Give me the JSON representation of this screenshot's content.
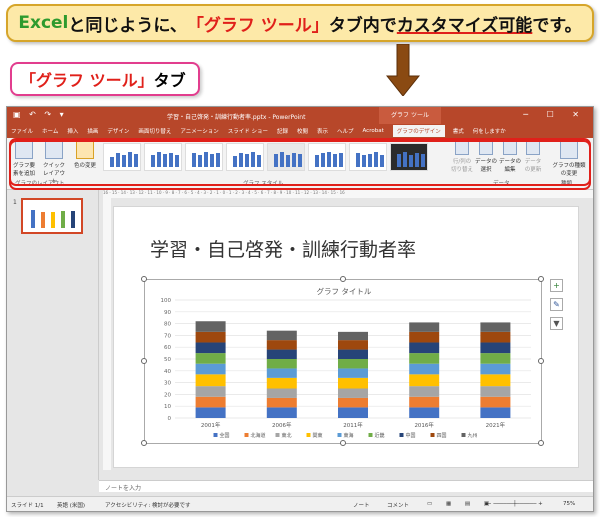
{
  "banner": {
    "part1": "Excel",
    "part2": "と同じように、",
    "part3": "「グラフ ツール」",
    "part4": "タブ内で",
    "part5": "カスタマイズ可能",
    "part6": "です。"
  },
  "tag": {
    "part1": "「グラフ ツール」",
    "part2": "タブ"
  },
  "window": {
    "title": "学習・自己啓発・訓練行動者率.pptx - PowerPoint",
    "context_tab": "グラフ ツール",
    "tabs": [
      "ファイル",
      "ホーム",
      "挿入",
      "描画",
      "デザイン",
      "画面切り替え",
      "アニメーション",
      "スライド ショー",
      "記録",
      "校閲",
      "表示",
      "ヘルプ",
      "Acrobat",
      "グラフのデザイン",
      "書式"
    ],
    "active_tab": "グラフのデザイン",
    "tell_me": "何をしますか"
  },
  "ribbon": {
    "add_element": "グラフ要素を追加",
    "quick_layout": "クイックレイアウト",
    "change_colors": "色の変更",
    "layout_group": "グラフのレイアウト",
    "styles_group": "グラフ スタイル",
    "switch_rowcol": "行/列の切り替え",
    "select_data": "データの選択",
    "edit_data": "データの編集",
    "refresh_data": "データの更新",
    "data_group": "データ",
    "change_type": "グラフの種類の変更",
    "type_group": "種類"
  },
  "ruler_text": "16 · 15 · 14 · 13 · 12 · 11 · 10 · 9 · 8 · 7 · 6 · 5 · 4 · 3 · 2 · 1 · 0 · 1 · 2 · 3 · 4 · 5 · 6 · 7 · 8 · 9 · 10 · 11 · 12 · 13 · 14 · 15 · 16",
  "slide_number": "1",
  "slide_title": "学習・自己啓発・訓練行動者率",
  "notes_placeholder": "ノートを入力",
  "status": {
    "slide": "スライド 1/1",
    "language": "英語 (米国)",
    "accessibility": "アクセシビリティ: 検討が必要です",
    "notes": "ノート",
    "comments": "コメント",
    "zoom": "75%"
  },
  "colors": {
    "powerpoint": "#b7472a",
    "highlight": "#e0201a"
  },
  "chart_data": {
    "type": "bar",
    "title": "グラフ タイトル",
    "categories": [
      "2001年",
      "2006年",
      "2011年",
      "2016年",
      "2021年"
    ],
    "ylim": [
      0,
      100
    ],
    "yticks": [
      0,
      10,
      20,
      30,
      40,
      50,
      60,
      70,
      80,
      90,
      100
    ],
    "series": [
      {
        "name": "全国",
        "color": "#4472c4",
        "values": [
          9,
          9,
          9,
          9,
          9
        ]
      },
      {
        "name": "北海道",
        "color": "#ed7d31",
        "values": [
          9,
          8,
          8,
          9,
          9
        ]
      },
      {
        "name": "東北",
        "color": "#a5a5a5",
        "values": [
          9,
          8,
          8,
          9,
          9
        ]
      },
      {
        "name": "関東",
        "color": "#ffc000",
        "values": [
          10,
          9,
          9,
          10,
          10
        ]
      },
      {
        "name": "東海",
        "color": "#5b9bd5",
        "values": [
          9,
          8,
          8,
          9,
          9
        ]
      },
      {
        "name": "近畿",
        "color": "#70ad47",
        "values": [
          9,
          8,
          8,
          9,
          9
        ]
      },
      {
        "name": "中国",
        "color": "#264478",
        "values": [
          9,
          8,
          8,
          9,
          9
        ]
      },
      {
        "name": "四国",
        "color": "#9e480e",
        "values": [
          9,
          8,
          8,
          9,
          9
        ]
      },
      {
        "name": "九州",
        "color": "#636363",
        "values": [
          9,
          8,
          7,
          8,
          8
        ]
      }
    ],
    "legend_position": "bottom"
  }
}
